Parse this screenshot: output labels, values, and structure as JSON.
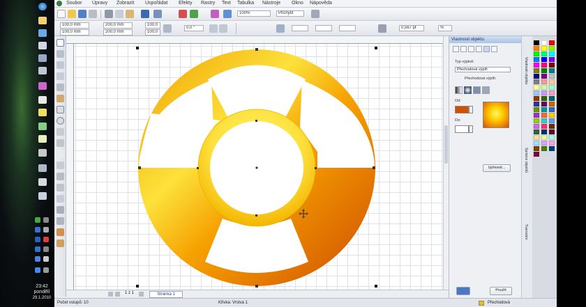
{
  "menu": {
    "items": [
      "Soubor",
      "Úpravy",
      "Zobrazit",
      "Uspořádat",
      "Efekty",
      "Rastry",
      "Text",
      "Tabulka",
      "Nástroje",
      "Okno",
      "Nápověda"
    ]
  },
  "toolbar": {
    "zoom": "100%",
    "snap": "Přichytit",
    "pos_x": "100,0 mm",
    "pos_y": "100,0 mm",
    "width": "200,0 mm",
    "height": "200,0 mm",
    "scale_w": "100,0",
    "scale_h": "100,0",
    "angle": "0,0 °",
    "outline": "0,567 pt",
    "percent": "%"
  },
  "docker": {
    "title": "Vlastnosti objektu",
    "fill_type_label": "Typ výplně:",
    "fill_type_value": "Přechodová výplň",
    "gradient_label": "Přechodová výplň:",
    "from_label": "Od:",
    "to_label": "Do:",
    "more_button": "Upřesnit...",
    "apply_button": "Použít",
    "side_tabs": [
      "Vlastnosti objektu",
      "Správce objektů",
      "Tvarování"
    ]
  },
  "pagebar": {
    "page_info": "1 z 1",
    "page_tab": "Stránka 1"
  },
  "status": {
    "left": "Počet vstupů: 10",
    "middle": "Křivka: Vrstva 1",
    "fill_swatch_label": "Přechodová"
  },
  "clock": {
    "time": "23:42",
    "day": "pondělí",
    "date": "29.1.2010"
  },
  "colors": {
    "ring_dark": "#d45a00",
    "ring_mid": "#f7a200",
    "ring_light": "#fff24a",
    "inner_light": "#fff56a",
    "inner_mid": "#fcd420",
    "accent": "#a9c4e6"
  },
  "palette_colors": [
    "#000000",
    "#ffffff",
    "#ff0000",
    "#ff8000",
    "#ffff00",
    "#80ff00",
    "#00ff00",
    "#00ff80",
    "#00ffff",
    "#0080ff",
    "#0000ff",
    "#8000ff",
    "#ff00ff",
    "#ff0080",
    "#800000",
    "#808000",
    "#008000",
    "#008080",
    "#000080",
    "#800080",
    "#c0c0c0",
    "#808080",
    "#ff9999",
    "#ffcc99",
    "#ffff99",
    "#ccff99",
    "#99ffcc",
    "#99ccff",
    "#cc99ff",
    "#ff99cc",
    "#993300",
    "#336600",
    "#006666",
    "#333399",
    "#660066",
    "#cc6600",
    "#669900",
    "#009999",
    "#3366cc",
    "#9933cc",
    "#ff6633",
    "#ffcc00",
    "#99cc00",
    "#33cccc",
    "#6699ff",
    "#cc66ff",
    "#ff3366",
    "#663300",
    "#336633",
    "#003366",
    "#660033",
    "#ffe0a0",
    "#e0ffa0",
    "#a0ffe0",
    "#a0e0ff",
    "#e0a0ff",
    "#ffa0e0",
    "#804000",
    "#408000",
    "#004080",
    "#800040"
  ]
}
